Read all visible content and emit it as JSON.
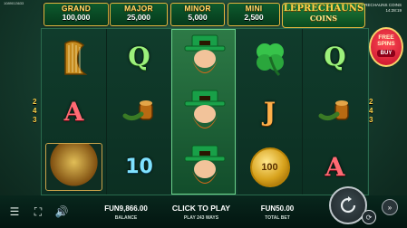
{
  "header": {
    "game_id": "1089013633",
    "brand_title": "LEPRECHAUNS COINS",
    "time": "14:28:19"
  },
  "jackpots": [
    {
      "name": "GRAND",
      "value": "100,000"
    },
    {
      "name": "MAJOR",
      "value": "25,000"
    },
    {
      "name": "MINOR",
      "value": "5,000"
    },
    {
      "name": "MINI",
      "value": "2,500"
    }
  ],
  "logo": {
    "line1": "LEPRECHAUNS",
    "line2": "COINS"
  },
  "free_spins": {
    "line1": "FREE",
    "line2": "SPINS",
    "buy": "BUY"
  },
  "reels": [
    [
      "harp",
      "A",
      "pot-of-gold"
    ],
    [
      "Q",
      "pipe",
      "10"
    ],
    [
      "leprechaun",
      "leprechaun",
      "leprechaun"
    ],
    [
      "clover",
      "J",
      "100"
    ],
    [
      "Q",
      "pipe",
      "A"
    ]
  ],
  "symbol_texts": {
    "r0_1": "A",
    "r1_0": "Q",
    "r1_2": "10",
    "r3_1": "J",
    "r3_2_coin": "100",
    "r4_0": "Q",
    "r4_2": "A"
  },
  "payline_markers_left": [
    "2",
    "4",
    "3"
  ],
  "payline_markers_right": [
    "2",
    "4",
    "3"
  ],
  "bottom": {
    "balance_value": "FUN9,866.00",
    "balance_label": "BALANCE",
    "play_label": "CLICK TO PLAY",
    "play_sub": "PLAY 243 WAYS",
    "bet_value": "FUN50.00",
    "bet_label": "TOTAL BET"
  },
  "colors": {
    "gold": "#e6b63f",
    "jackpot_green": "#0d5a2d",
    "free_spins_red": "#e21b35"
  },
  "icons": [
    "menu-icon",
    "fullscreen-icon",
    "sound-icon",
    "spin-icon",
    "autoplay-icon",
    "turbo-icon"
  ]
}
